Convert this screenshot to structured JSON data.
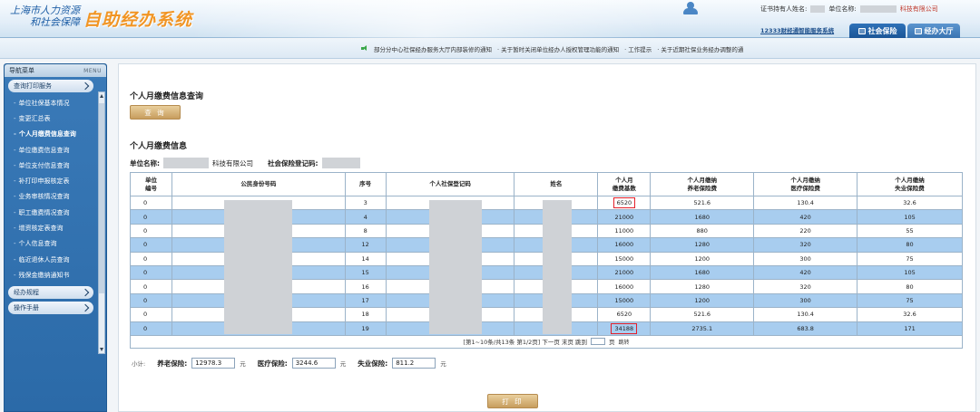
{
  "header": {
    "logo_line1": "上海市人力资源",
    "logo_line2": "和社会保障",
    "system_title": "自助经办系统",
    "cert_holder_label": "证书持有人姓名:",
    "company_name_label": "单位名称:",
    "company_suffix": "科技有限公司",
    "service_link": "12333财经通智能服务系统",
    "tabs": [
      {
        "label": "社会保险",
        "active": true
      },
      {
        "label": "经办大厅",
        "active": false
      }
    ]
  },
  "notices": [
    "部分分中心社保经办服务大厅内部装修的通知",
    "· 关于暂时关闭单位经办人授权管理功能的通知",
    "· 工作提示",
    "· 关于近期社保业务经办调整的通"
  ],
  "sidebar": {
    "title": "导航菜单",
    "title_en": "MENU",
    "section_query": "查询打印服务",
    "items": [
      "单位社保基本情况",
      "变更汇总表",
      "个人月缴费信息查询",
      "单位缴费信息查询",
      "单位支付信息查询",
      "补打印申报核定表",
      "业务审核情况查询",
      "职工缴费情况查询",
      "增资核定表查询",
      "个人信息查询",
      "临近退休人员查询",
      "残保金缴纳通知书"
    ],
    "active_item": 2,
    "section_process": "经办规程",
    "section_manual": "操作手册"
  },
  "main": {
    "query_title": "个人月缴费信息查询",
    "query_button": "查 询",
    "info_title": "个人月缴费信息",
    "company_label": "单位名称:",
    "company_value": "科技有限公司",
    "reg_label": "社会保险登记码:",
    "table": {
      "headers": [
        "单位\n编号",
        "公民身份号码",
        "序号",
        "个人社保登记码",
        "姓名",
        "个人月\n缴费基数",
        "个人月缴纳\n养老保险费",
        "个人月缴纳\n医疗保险费",
        "个人月缴纳\n失业保险费"
      ],
      "rows": [
        {
          "unit": "0",
          "seq": "3",
          "base": "6520",
          "pension": "521.6",
          "medical": "130.4",
          "unemp": "32.6",
          "hl": true
        },
        {
          "unit": "0",
          "seq": "4",
          "base": "21000",
          "pension": "1680",
          "medical": "420",
          "unemp": "105"
        },
        {
          "unit": "0",
          "seq": "8",
          "base": "11000",
          "pension": "880",
          "medical": "220",
          "unemp": "55"
        },
        {
          "unit": "0",
          "seq": "12",
          "base": "16000",
          "pension": "1280",
          "medical": "320",
          "unemp": "80"
        },
        {
          "unit": "0",
          "seq": "14",
          "base": "15000",
          "pension": "1200",
          "medical": "300",
          "unemp": "75"
        },
        {
          "unit": "0",
          "seq": "15",
          "base": "21000",
          "pension": "1680",
          "medical": "420",
          "unemp": "105"
        },
        {
          "unit": "0",
          "seq": "16",
          "base": "16000",
          "pension": "1280",
          "medical": "320",
          "unemp": "80"
        },
        {
          "unit": "0",
          "seq": "17",
          "base": "15000",
          "pension": "1200",
          "medical": "300",
          "unemp": "75"
        },
        {
          "unit": "0",
          "seq": "18",
          "base": "6520",
          "pension": "521.6",
          "medical": "130.4",
          "unemp": "32.6"
        },
        {
          "unit": "0",
          "seq": "19",
          "base": "34188",
          "pension": "2735.1",
          "medical": "683.8",
          "unemp": "171",
          "hl": true
        }
      ],
      "pager_text": "[第1~10条/共13条 第1/2页] 下一页 末页 跳到",
      "pager_page_suffix": "页",
      "pager_go": "跳转"
    },
    "summary": {
      "subtotal_label": "小计:",
      "pension_label": "养老保险:",
      "pension_value": "12978.3",
      "medical_label": "医疗保险:",
      "medical_value": "3244.6",
      "unemp_label": "失业保险:",
      "unemp_value": "811.2",
      "unit": "元"
    },
    "print_button": "打 印"
  }
}
